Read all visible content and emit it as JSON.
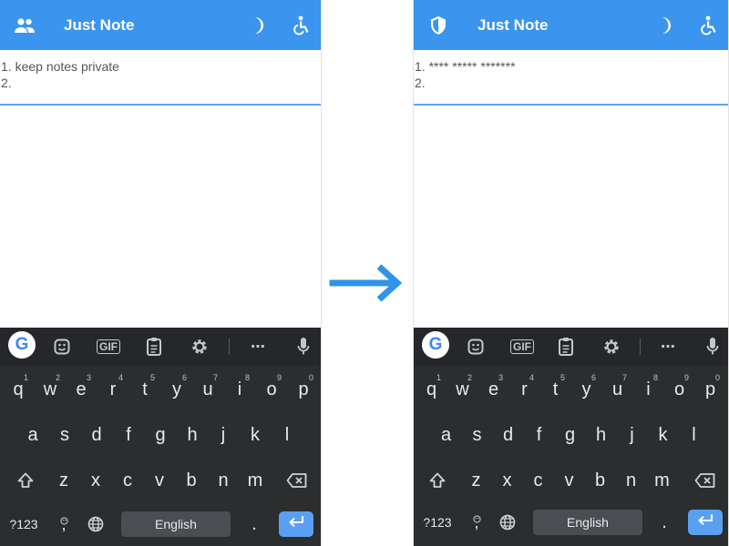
{
  "colors": {
    "appbar": "#3b94ee",
    "keyboard": "#2b2d2f",
    "enter": "#5aa0f2",
    "arrow": "#2f93ea"
  },
  "before": {
    "appbar": {
      "title": "Just Note",
      "lead_icon": "people-icon",
      "actions": [
        "moon-icon",
        "accessibility-icon"
      ]
    },
    "note": {
      "lines": [
        "1. keep notes private",
        "2."
      ]
    }
  },
  "after": {
    "appbar": {
      "title": "Just Note",
      "lead_icon": "shield-icon",
      "actions": [
        "moon-icon",
        "accessibility-icon"
      ]
    },
    "note": {
      "lines": [
        "1. **** ***** *******",
        "2."
      ]
    }
  },
  "keyboard": {
    "toolbar": [
      "google-icon",
      "sticker-icon",
      "gif-icon",
      "clipboard-icon",
      "settings-icon",
      "more-icon",
      "mic-icon"
    ],
    "gif_label": "GIF",
    "google_letter": "G",
    "row1": [
      "q",
      "w",
      "e",
      "r",
      "t",
      "y",
      "u",
      "i",
      "o",
      "p"
    ],
    "row1_sup": [
      "1",
      "2",
      "3",
      "4",
      "5",
      "6",
      "7",
      "8",
      "9",
      "0"
    ],
    "row2": [
      "a",
      "s",
      "d",
      "f",
      "g",
      "h",
      "j",
      "k",
      "l"
    ],
    "row3": [
      "z",
      "x",
      "c",
      "v",
      "b",
      "n",
      "m"
    ],
    "symbols_label": "?123",
    "comma_label": ",",
    "period_label": ".",
    "space_label": "English",
    "more": "⋯"
  }
}
